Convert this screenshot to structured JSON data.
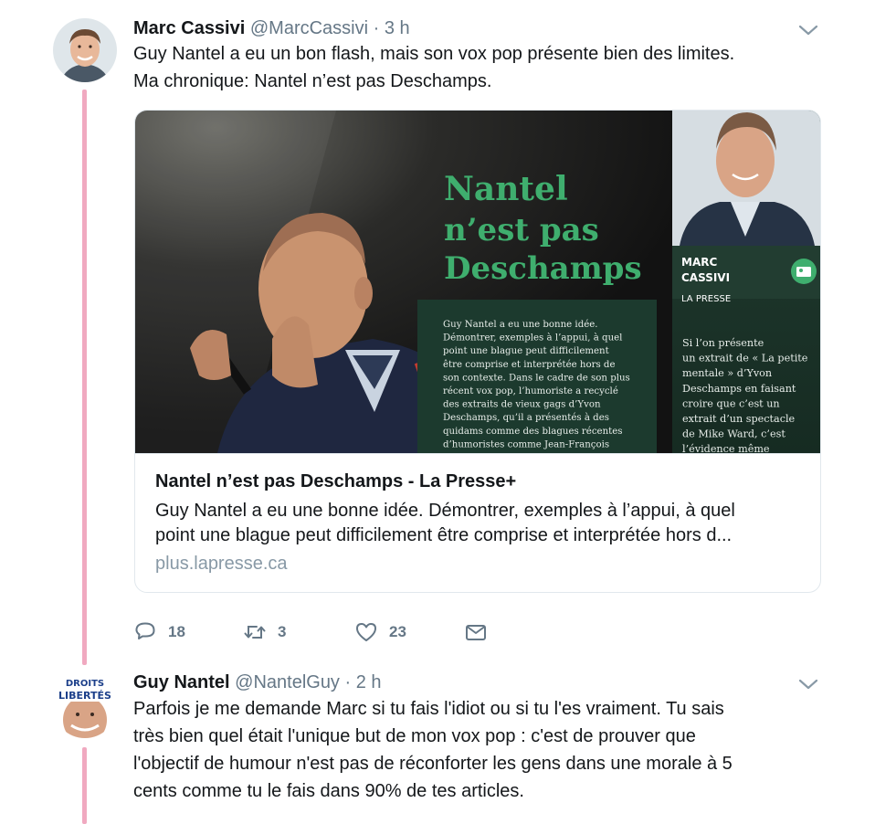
{
  "tweet1": {
    "name": "Marc Cassivi",
    "handle": "@MarcCassivi",
    "dot": "·",
    "time": "3 h",
    "line1": "Guy Nantel a eu un bon flash, mais son vox pop présente bien des limites.",
    "line2": "Ma chronique: Nantel n’est pas Deschamps.",
    "card": {
      "headline_line1": "Nantel",
      "headline_line2": "n’est pas",
      "headline_line3": "Deschamps",
      "article_excerpt": [
        "Guy Nantel a eu une bonne idée.",
        "Démontrer, exemples à l’appui, à quel",
        "point une blague peut difficilement",
        "être comprise et interprétée hors de",
        "son contexte. Dans le cadre de son plus",
        "récent vox pop, l’humoriste a recyclé",
        "des extraits de vieux gags d’Yvon",
        "Deschamps, qu’il a présentés à des",
        "quidams comme des blagues récentes",
        "d’humoristes comme Jean-François"
      ],
      "author_first": "MARC",
      "author_last": "CASSIVI",
      "publication": "LA PRESSE",
      "side_excerpt": [
        "Si l’on présente",
        "un extrait de « La petite",
        "mentale » d’Yvon",
        "Deschamps en faisant",
        "croire que c’est un",
        "extrait d’un spectacle",
        "de Mike Ward, c’est",
        "l’évidence même"
      ],
      "title": "Nantel n’est pas Deschamps - La Presse+",
      "desc_line1": "Guy Nantel a eu une bonne idée. Démontrer, exemples à l’appui, à quel",
      "desc_line2": "point une blague peut difficilement être comprise et interprétée hors d...",
      "domain": "plus.lapresse.ca"
    },
    "actions": {
      "replies": "18",
      "retweets": "3",
      "likes": "23"
    }
  },
  "tweet2": {
    "name": "Guy Nantel",
    "handle": "@NantelGuy",
    "dot": "·",
    "time": "2 h",
    "avatar_text_top": "DROITS",
    "avatar_text_bottom": "LIBERTÉS",
    "lines": [
      "Parfois je me demande Marc si tu fais l'idiot ou si tu l'es vraiment. Tu sais",
      "très bien quel était l'unique but de mon vox pop : c'est de prouver que",
      "l'objectif de humour n'est pas de réconforter les gens dans une morale à 5",
      "cents comme tu le fais dans 90% de tes articles."
    ]
  },
  "colors": {
    "thread_line": "#f0a9c0",
    "secondary_text": "#657786",
    "card_headline_green": "#3fae6e",
    "panel_dark_green": "#1c3a2e"
  }
}
